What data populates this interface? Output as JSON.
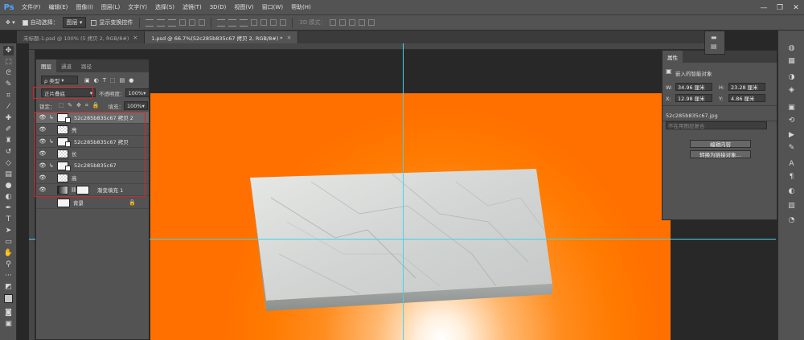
{
  "app": {
    "logo": "Ps"
  },
  "menu": [
    "文件(F)",
    "编辑(E)",
    "图像(I)",
    "图层(L)",
    "文字(Y)",
    "选择(S)",
    "滤镜(T)",
    "3D(D)",
    "视图(V)",
    "窗口(W)",
    "帮助(H)"
  ],
  "window_controls": {
    "minimize": "—",
    "restore": "❐",
    "close": "✕"
  },
  "options_bar": {
    "auto_select_label": "自动选择：",
    "auto_select_value": "图层",
    "show_transform_label": "显示变换控件",
    "mode_3d_label": "3D 模式："
  },
  "tabs": [
    {
      "label": "未标题-1.psd @ 100% (5 拷贝 2, RGB/8#)",
      "close": "×"
    },
    {
      "label": "1.psd @ 66.7%(52c285b835c67 拷贝 2, RGB/8#) *",
      "close": "×"
    }
  ],
  "layers_panel": {
    "tabs": [
      "图层",
      "通道",
      "路径"
    ],
    "filter_kind": "ρ 类型",
    "blend_mode": "正片叠底",
    "opacity_label": "不透明度：",
    "opacity_value": "100%",
    "lock_label": "锁定：",
    "fill_label": "填充：",
    "fill_value": "100%",
    "layers": [
      {
        "name": "52c285b835c67 拷贝 2",
        "thumb": "smart",
        "clipped": true,
        "selected": true,
        "visible": true
      },
      {
        "name": "亮",
        "thumb": "check",
        "clipped": false,
        "selected": false,
        "visible": true
      },
      {
        "name": "52c285b835c67 拷贝",
        "thumb": "smart",
        "clipped": true,
        "selected": false,
        "visible": true
      },
      {
        "name": "长",
        "thumb": "check",
        "clipped": false,
        "selected": false,
        "visible": true
      },
      {
        "name": "52c285b835c67",
        "thumb": "smart",
        "clipped": true,
        "selected": false,
        "visible": true
      },
      {
        "name": "高",
        "thumb": "check",
        "clipped": false,
        "selected": false,
        "visible": true
      },
      {
        "name": "渐变填充 1",
        "thumb": "gradient",
        "clipped": false,
        "selected": false,
        "visible": true
      },
      {
        "name": "背景",
        "thumb": "white",
        "clipped": false,
        "selected": false,
        "visible": false,
        "locked": true
      }
    ]
  },
  "properties_panel": {
    "tab": "属性",
    "title": "嵌入的智能对象",
    "w_label": "W:",
    "w_value": "34.96 厘米",
    "h_label": "H:",
    "h_value": "23.28 厘米",
    "x_label": "X:",
    "x_value": "12.98 厘米",
    "y_label": "Y:",
    "y_value": "4.86 厘米",
    "filename": "52c285b835c67.jpg",
    "comp_placeholder": "不在用图层复合",
    "edit_button": "编辑内容",
    "convert_button": "转换为链接对象..."
  },
  "colors": {
    "canvas_orange": "#ff7a00",
    "guide": "#45d3e8",
    "highlight_red": "#d6262a",
    "chrome": "#535353"
  }
}
